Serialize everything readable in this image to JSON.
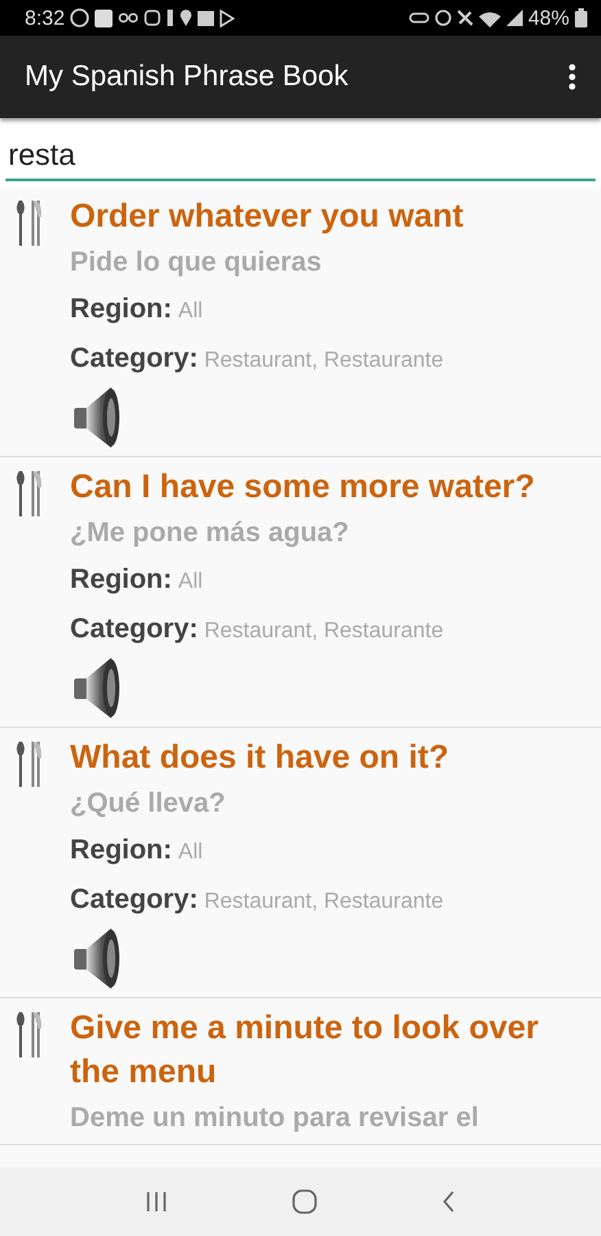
{
  "status_bar": {
    "time": "8:32",
    "battery": "48%"
  },
  "app_bar": {
    "title": "My Spanish Phrase Book"
  },
  "search": {
    "value": "resta"
  },
  "phrases": [
    {
      "title": "Order whatever you want",
      "translation": "Pide lo que quieras",
      "region_label": "Region:",
      "region": "All",
      "category_label": "Category:",
      "category": "Restaurant, Restaurante"
    },
    {
      "title": "Can I have some more water?",
      "translation": "¿Me pone más agua?",
      "region_label": "Region:",
      "region": "All",
      "category_label": "Category:",
      "category": "Restaurant, Restaurante"
    },
    {
      "title": "What does it have on it?",
      "translation": "¿Qué lleva?",
      "region_label": "Region:",
      "region": "All",
      "category_label": "Category:",
      "category": "Restaurant, Restaurante"
    },
    {
      "title": "Give me a minute to look over the menu",
      "translation": "Deme un minuto para revisar el"
    }
  ]
}
